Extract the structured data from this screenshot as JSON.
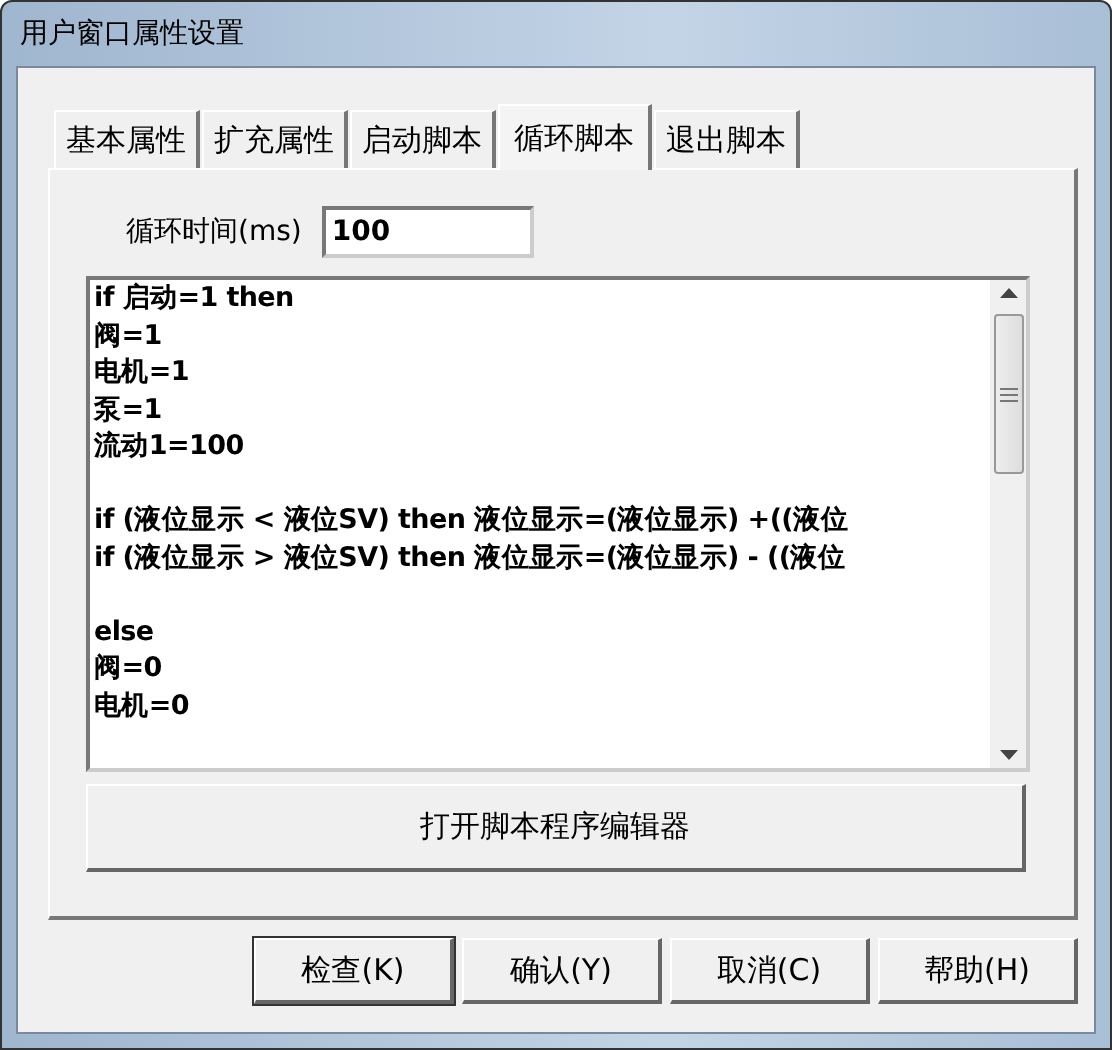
{
  "window": {
    "title": "用户窗口属性设置"
  },
  "tabs": [
    {
      "label": "基本属性",
      "selected": false
    },
    {
      "label": "扩充属性",
      "selected": false
    },
    {
      "label": "启动脚本",
      "selected": false
    },
    {
      "label": "循环脚本",
      "selected": true
    },
    {
      "label": "退出脚本",
      "selected": false
    }
  ],
  "cycle_time": {
    "label": "循环时间(ms)",
    "value": "100"
  },
  "script_editor": {
    "blocks": [
      [
        "if 启动=1 then",
        "阀=1",
        "电机=1",
        "泵=1",
        "流动1=100"
      ],
      [
        "if (液位显示 < 液位SV) then 液位显示=(液位显示) +((液位",
        "if (液位显示 > 液位SV) then 液位显示=(液位显示) - ((液位"
      ],
      [
        "else",
        "阀=0",
        "电机=0"
      ]
    ]
  },
  "open_editor_button": "打开脚本程序编辑器",
  "buttons": [
    {
      "label": "检查(K)",
      "default": true
    },
    {
      "label": "确认(Y)",
      "default": false
    },
    {
      "label": "取消(C)",
      "default": false
    },
    {
      "label": "帮助(H)",
      "default": false
    }
  ]
}
